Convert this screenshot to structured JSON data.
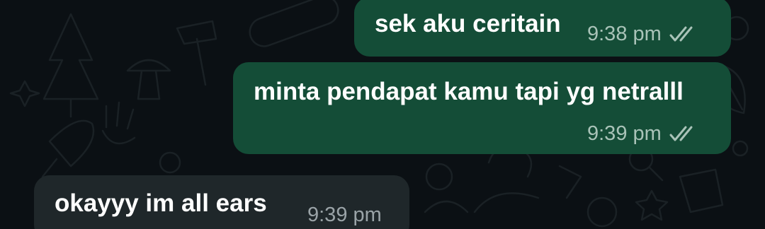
{
  "conversation": {
    "messages": [
      {
        "direction": "outgoing",
        "text": "sek aku ceritain",
        "time": "9:38 pm",
        "status_icon": "double-check-icon"
      },
      {
        "direction": "outgoing",
        "text": "minta pendapat kamu tapi yg netralll",
        "time": "9:39 pm",
        "status_icon": "double-check-icon"
      },
      {
        "direction": "incoming",
        "text": "okayyy im all ears",
        "time": "9:39 pm"
      }
    ]
  },
  "colors": {
    "background": "#0b1014",
    "outgoing_bubble": "#144d37",
    "incoming_bubble": "#1f272a",
    "message_text": "#ffffff",
    "timestamp_outgoing": "#a9c3b8",
    "timestamp_incoming": "#9aa3a7",
    "tick_icon": "#a9c3b8"
  }
}
